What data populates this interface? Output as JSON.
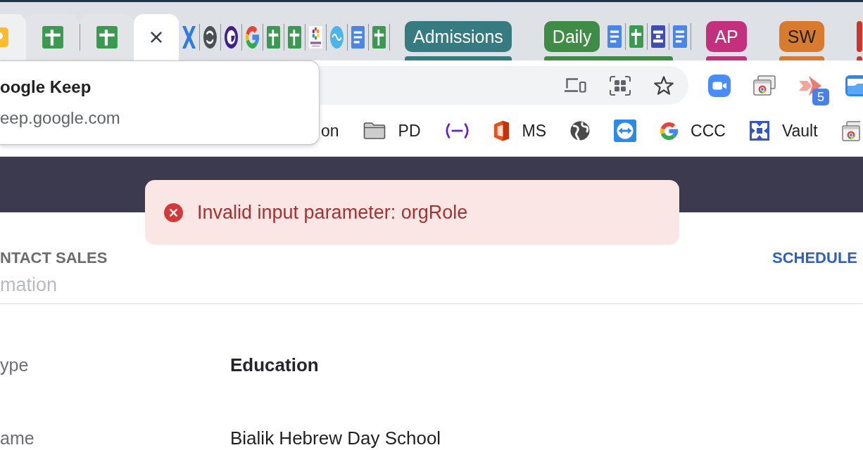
{
  "browser": {
    "tabs": [
      {
        "kind": "tile",
        "hovered": true,
        "selected": false
      },
      {
        "kind": "sheet",
        "hovered": false,
        "selected": false
      },
      {
        "kind": "sheet",
        "hovered": false,
        "selected": false
      },
      {
        "kind": "close",
        "hovered": false,
        "selected": true
      }
    ],
    "pinned_tabs": [
      {
        "kind": "xmark"
      },
      {
        "kind": "swirl"
      },
      {
        "kind": "ring"
      },
      {
        "kind": "gletter"
      },
      {
        "kind": "sheet"
      },
      {
        "kind": "sheet"
      },
      {
        "kind": "emblem"
      },
      {
        "kind": "oval"
      },
      {
        "kind": "doc"
      },
      {
        "kind": "sheet"
      }
    ],
    "tab_groups": [
      {
        "label": "Admissions",
        "color": "#357b80"
      },
      {
        "label": "Daily",
        "color": "#3e8c46",
        "tabs": [
          {
            "kind": "doc"
          },
          {
            "kind": "sheet"
          },
          {
            "kind": "form"
          },
          {
            "kind": "doc"
          }
        ]
      },
      {
        "label": "AP",
        "color": "#c3307e"
      },
      {
        "label": "SW",
        "color": "#d97b2e"
      },
      {
        "color": "#c8392c"
      }
    ],
    "toolbar": {
      "omnibox_icons": [
        {
          "kind": "devices"
        },
        {
          "kind": "scan"
        },
        {
          "kind": "star"
        }
      ],
      "extensions": [
        {
          "kind": "camera"
        },
        {
          "kind": "windows"
        },
        {
          "kind": "arrow",
          "badge": "5"
        },
        {
          "kind": "panel"
        }
      ]
    },
    "hover_card": {
      "title": "oogle Keep",
      "url": "eep.google.com"
    },
    "bookmarks": [
      {
        "kind": "text",
        "label": "on"
      },
      {
        "kind": "folder",
        "label": "PD"
      },
      {
        "kind": "brackets"
      },
      {
        "kind": "office",
        "label": "MS"
      },
      {
        "kind": "globe"
      },
      {
        "kind": "arrows"
      },
      {
        "kind": "gletter",
        "label": "CCC"
      },
      {
        "kind": "vault",
        "label": "Vault"
      },
      {
        "kind": "windows"
      }
    ]
  },
  "page": {
    "toast": {
      "kind": "error",
      "message": "Invalid input parameter: orgRole"
    },
    "nav": {
      "left_link": "NTACT SALES",
      "right_link": "SCHEDULE",
      "section_title": "mation"
    },
    "details": [
      {
        "label": "ype",
        "value": "Education",
        "emphasis": true
      },
      {
        "label": "ame",
        "value": "Bialik Hebrew Day School",
        "emphasis": false
      }
    ]
  }
}
